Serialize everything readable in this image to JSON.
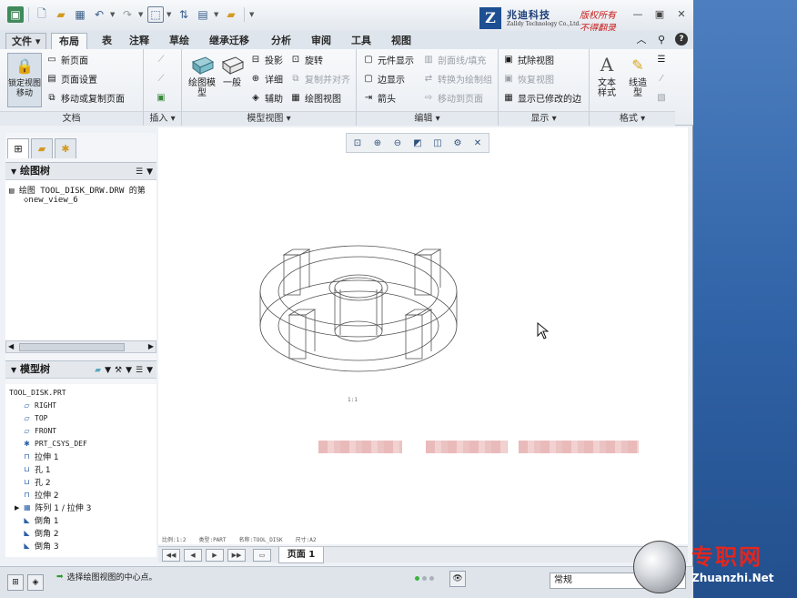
{
  "titlebar": {
    "brand_cn": "兆迪科技",
    "brand_en": "Zalldy Technology Co.,Ltd.",
    "slogan1": "版权所有",
    "slogan2": "不得翻录"
  },
  "menu": {
    "file": "文件",
    "tabs": [
      "布局",
      "表",
      "注释",
      "草绘",
      "继承迁移",
      "分析",
      "审阅",
      "工具",
      "视图"
    ],
    "active_tab": "布局"
  },
  "ribbon": {
    "doc": {
      "lock_label": "锁定视图移动",
      "new_page": "新页面",
      "page_setup": "页面设置",
      "move_copy": "移动或复制页面",
      "group": "文档"
    },
    "insert": {
      "group": "插入"
    },
    "model_views": {
      "drawing_model": "绘图模型",
      "general": "一般",
      "projection": "投影",
      "rotate": "旋转",
      "detail": "详细",
      "copy_align": "复制并对齐",
      "auxiliary": "辅助",
      "drawing_view": "绘图视图",
      "group": "模型视图"
    },
    "edit": {
      "element_display": "元件显示",
      "section_fill": "剖面线/填充",
      "edge_display": "边显示",
      "convert_draw_group": "转换为绘制组",
      "arrow": "箭头",
      "move_to_page": "移动到页面",
      "group": "编辑"
    },
    "display": {
      "erase_view": "拭除视图",
      "restore_view": "恢复视图",
      "show_modified_edges": "显示已修改的边",
      "group": "显示"
    },
    "format": {
      "text_style": "文本样式",
      "line_style": "线造型",
      "group": "格式"
    }
  },
  "drawing_tree": {
    "title": "绘图树",
    "root": "绘图 TOOL_DISK_DRW.DRW 的第",
    "child": "new_view_6"
  },
  "model_tree": {
    "title": "模型树",
    "root": "TOOL_DISK.PRT",
    "items": [
      "RIGHT",
      "TOP",
      "FRONT",
      "PRT_CSYS_DEF",
      "拉伸 1",
      "孔 1",
      "孔 2",
      "拉伸 2",
      "阵列 1 / 拉伸 3",
      "倒角 1",
      "倒角 2",
      "倒角 3"
    ]
  },
  "canvas": {
    "view_scale_note": "1:1",
    "info_scale": "比例:1:2",
    "info_type": "类型:PART",
    "info_name": "名称:TOOL_DISK",
    "info_size": "尺寸:A2"
  },
  "pagebar": {
    "page_tab": "页面 1"
  },
  "status": {
    "message": "选择绘图视图的中心点。",
    "filter_value": "常规"
  },
  "watermark": {
    "cn": "专职网",
    "en": "Zhuanzhi.Net"
  }
}
